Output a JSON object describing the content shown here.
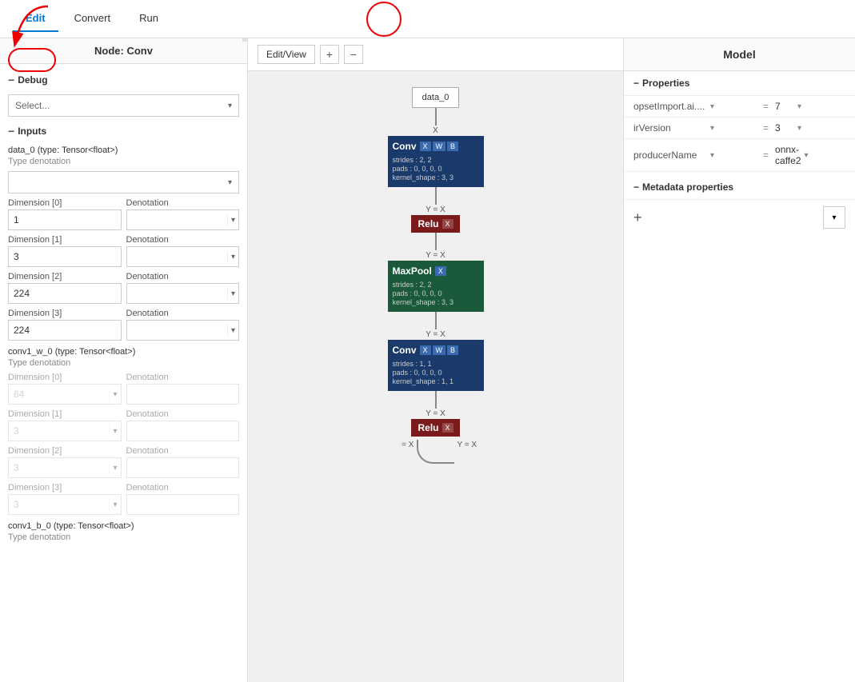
{
  "menuBar": {
    "items": [
      {
        "label": "Edit",
        "active": true
      },
      {
        "label": "Convert",
        "active": false
      },
      {
        "label": "Run",
        "active": false
      }
    ]
  },
  "leftPanel": {
    "title": "Node: Conv",
    "debugLabel": "Debug",
    "selectPlaceholder": "Select...",
    "inputsLabel": "Inputs",
    "fields": [
      {
        "name": "data_0 (type: Tensor<float>)",
        "typeDenotation": "Type denotation",
        "dims": [
          {
            "dimLabel": "Dimension [0]",
            "dimValue": "1",
            "denLabel": "Denotation",
            "denValue": ""
          },
          {
            "dimLabel": "Dimension [1]",
            "dimValue": "3",
            "denLabel": "Denotation",
            "denValue": ""
          },
          {
            "dimLabel": "Dimension [2]",
            "dimValue": "224",
            "denLabel": "Denotation",
            "denValue": ""
          },
          {
            "dimLabel": "Dimension [3]",
            "dimValue": "224",
            "denLabel": "Denotation",
            "denValue": ""
          }
        ]
      },
      {
        "name": "conv1_w_0 (type: Tensor<float>)",
        "typeDenotation": "Type denotation",
        "dims": [
          {
            "dimLabel": "Dimension [0]",
            "dimValue": "64",
            "denLabel": "Denotation",
            "denValue": ""
          },
          {
            "dimLabel": "Dimension [1]",
            "dimValue": "3",
            "denLabel": "Denotation",
            "denValue": ""
          },
          {
            "dimLabel": "Dimension [2]",
            "dimValue": "3",
            "denLabel": "Denotation",
            "denValue": ""
          },
          {
            "dimLabel": "Dimension [3]",
            "dimValue": "3",
            "denLabel": "Denotation",
            "denValue": ""
          }
        ]
      },
      {
        "name": "conv1_b_0 (type: Tensor<float>)",
        "typeDenotation": "Type denotation",
        "dims": []
      }
    ]
  },
  "centerPanel": {
    "editViewLabel": "Edit/View",
    "zoomIn": "+",
    "zoomOut": "−",
    "nodes": [
      {
        "type": "data",
        "label": "data_0"
      },
      {
        "connector": "X"
      },
      {
        "type": "conv",
        "title": "Conv",
        "inputs": [
          "X",
          "W",
          "B"
        ],
        "info": [
          "strides : 2, 2",
          "pads : 0, 0, 0, 0",
          "kernel_shape : 3, 3"
        ]
      },
      {
        "connector": "Y = X"
      },
      {
        "type": "relu",
        "title": "Relu",
        "input": "X"
      },
      {
        "connector": "Y = X"
      },
      {
        "type": "maxpool",
        "title": "MaxPool",
        "input": "X",
        "info": [
          "strides : 2, 2",
          "pads : 0, 0, 0, 0",
          "kernel_shape : 3, 3"
        ]
      },
      {
        "connector": "Y = X"
      },
      {
        "type": "conv",
        "title": "Conv",
        "inputs": [
          "X",
          "W",
          "B"
        ],
        "info": [
          "strides : 1, 1",
          "pads : 0, 0, 0, 0",
          "kernel_shape : 1, 1"
        ]
      },
      {
        "connector": "Y = X"
      },
      {
        "type": "relu",
        "title": "Relu",
        "input": "X"
      },
      {
        "connector2": "= X"
      }
    ]
  },
  "rightPanel": {
    "title": "Model",
    "propertiesLabel": "Properties",
    "properties": [
      {
        "name": "opsetImport.ai....",
        "eq": "=",
        "value": "7"
      },
      {
        "name": "irVersion",
        "eq": "=",
        "value": "3"
      },
      {
        "name": "producerName",
        "eq": "=",
        "value": "onnx-caffe2"
      }
    ],
    "metaLabel": "Metadata properties",
    "addLabel": "+"
  }
}
